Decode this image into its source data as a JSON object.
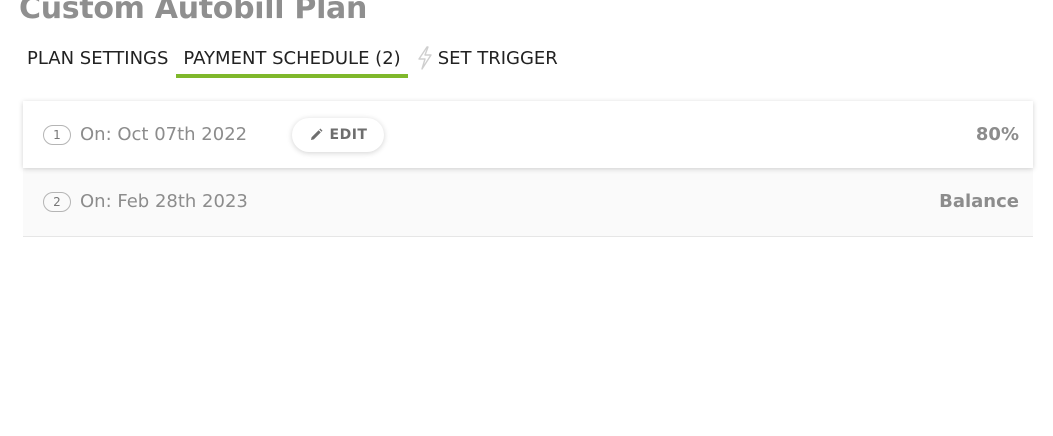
{
  "page": {
    "title": "Custom Autobill Plan"
  },
  "tabs": [
    {
      "label": "PLAN SETTINGS",
      "active": false
    },
    {
      "label": "PAYMENT SCHEDULE (2)",
      "active": true
    },
    {
      "label": "SET TRIGGER",
      "active": false,
      "icon": "bolt-icon"
    }
  ],
  "schedule": {
    "rows": [
      {
        "number": "1",
        "date": "On: Oct 07th 2022",
        "amount": "80%",
        "edit_label": "EDIT",
        "edit_icon": "pencil-icon"
      },
      {
        "number": "2",
        "date": "On: Feb 28th 2023",
        "amount": "Balance"
      }
    ]
  },
  "colors": {
    "accent": "#7fb82b",
    "title": "#8f8f8f",
    "muted_text": "#8c8c8c"
  }
}
